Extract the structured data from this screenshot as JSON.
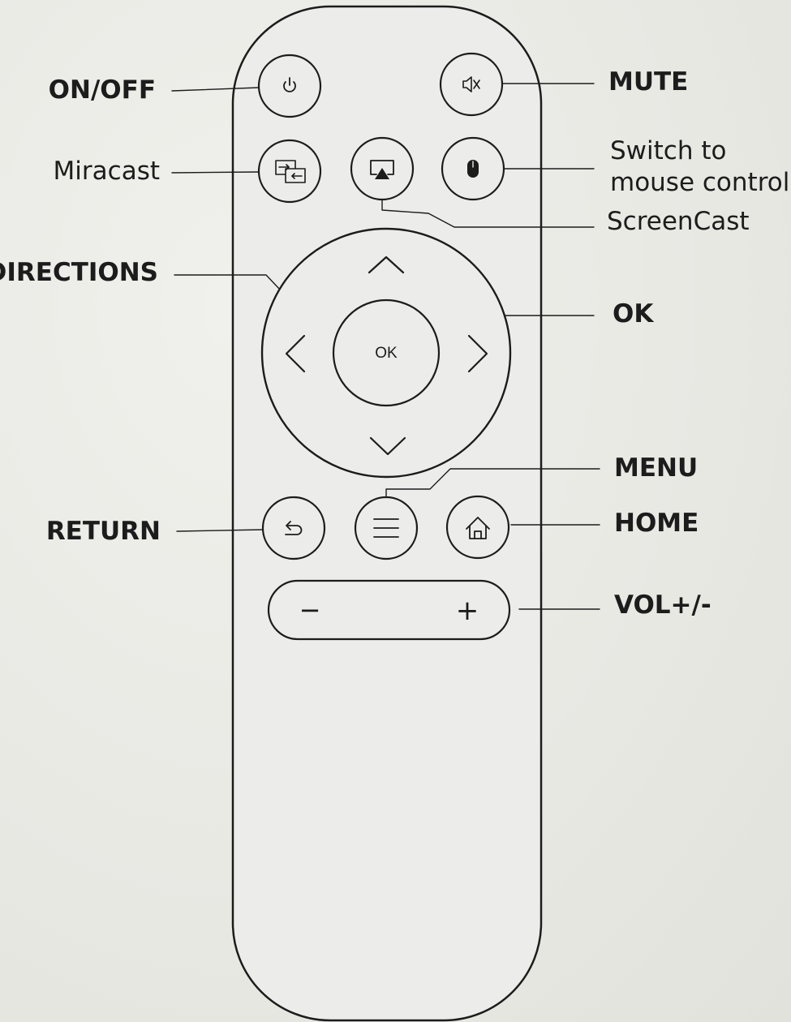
{
  "callouts": {
    "on_off": "ON/OFF",
    "miracast": "Miracast",
    "directions": "DIRECTIONS",
    "return": "RETURN",
    "mute": "MUTE",
    "switch_mouse_line1": "Switch to",
    "switch_mouse_line2": "mouse control",
    "screencast": "ScreenCast",
    "ok": "OK",
    "menu": "MENU",
    "home": "HOME",
    "vol": "VOL+/-"
  },
  "remote": {
    "ok_button_label": "OK",
    "vol_minus": "−",
    "vol_plus": "+"
  },
  "icons": {
    "power": "power-icon",
    "mute": "speaker-mute-icon",
    "miracast": "screen-mirror-icon",
    "screencast": "airplay-icon",
    "mouse": "mouse-icon",
    "up": "chevron-up-icon",
    "down": "chevron-down-icon",
    "left": "chevron-left-icon",
    "right": "chevron-right-icon",
    "return": "return-arrow-icon",
    "menu": "hamburger-menu-icon",
    "home": "home-icon"
  },
  "colors": {
    "paper": "#ebebe6",
    "ink": "#1c1c1c"
  }
}
